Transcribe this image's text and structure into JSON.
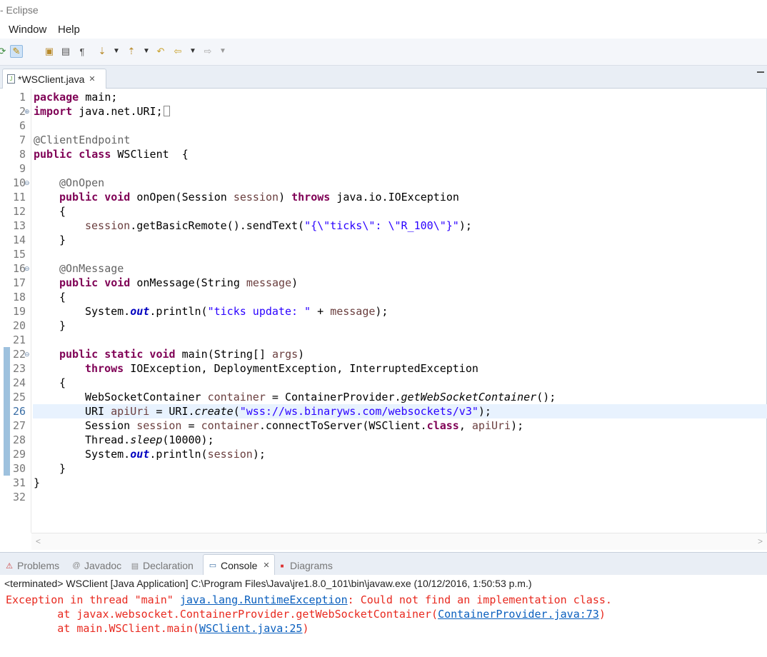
{
  "window": {
    "title": "- Eclipse"
  },
  "menu": {
    "items": [
      "Window",
      "Help"
    ]
  },
  "toolbar": {
    "icons": [
      "refresh-icon",
      "highlight-toggle-icon",
      "open-type-icon",
      "task-icon",
      "show-whitespace-icon",
      "next-annotation-icon",
      "previous-annotation-icon",
      "last-edit-location-icon",
      "back-icon",
      "forward-icon"
    ]
  },
  "editor": {
    "tab_label": "*WSClient.java",
    "tab_close": "✕",
    "highlighted_line": "26",
    "lines": [
      {
        "num": "1",
        "fold": ""
      },
      {
        "num": "2",
        "fold": "⊕"
      },
      {
        "num": "6",
        "fold": ""
      },
      {
        "num": "7",
        "fold": ""
      },
      {
        "num": "8",
        "fold": ""
      },
      {
        "num": "9",
        "fold": ""
      },
      {
        "num": "10",
        "fold": "⊖"
      },
      {
        "num": "11",
        "fold": ""
      },
      {
        "num": "12",
        "fold": ""
      },
      {
        "num": "13",
        "fold": ""
      },
      {
        "num": "14",
        "fold": ""
      },
      {
        "num": "15",
        "fold": ""
      },
      {
        "num": "16",
        "fold": "⊖"
      },
      {
        "num": "17",
        "fold": ""
      },
      {
        "num": "18",
        "fold": ""
      },
      {
        "num": "19",
        "fold": ""
      },
      {
        "num": "20",
        "fold": ""
      },
      {
        "num": "21",
        "fold": ""
      },
      {
        "num": "22",
        "fold": "⊖"
      },
      {
        "num": "23",
        "fold": ""
      },
      {
        "num": "24",
        "fold": ""
      },
      {
        "num": "25",
        "fold": ""
      },
      {
        "num": "26",
        "fold": ""
      },
      {
        "num": "27",
        "fold": ""
      },
      {
        "num": "28",
        "fold": ""
      },
      {
        "num": "29",
        "fold": ""
      },
      {
        "num": "30",
        "fold": ""
      },
      {
        "num": "31",
        "fold": ""
      },
      {
        "num": "32",
        "fold": ""
      }
    ],
    "code": {
      "l1_kw": "package",
      "l1_rest": " main;",
      "l2_kw": "import",
      "l2_rest": " java.net.URI;",
      "l7_ann": "@ClientEndpoint",
      "l8_kw": "public class",
      "l8_rest": " WSClient  {",
      "l10_ann": "@OnOpen",
      "l11_kw": "public void",
      "l11_a": " onOpen(Session ",
      "l11_var": "session",
      "l11_b": ") ",
      "l11_kw2": "throws",
      "l11_c": " java.io.IOException",
      "l12": "{",
      "l13_var": "session",
      "l13_a": ".getBasicRemote().sendText(",
      "l13_str": "\"{\\\"ticks\\\": \\\"R_100\\\"}\"",
      "l13_b": ");",
      "l14": "}",
      "l16_ann": "@OnMessage",
      "l17_kw": "public void",
      "l17_a": " onMessage(String ",
      "l17_var": "message",
      "l17_b": ")",
      "l18": "{",
      "l19_a": "System.",
      "l19_stat": "out",
      "l19_b": ".println(",
      "l19_str": "\"ticks update: \"",
      "l19_c": " + ",
      "l19_var": "message",
      "l19_d": ");",
      "l20": "}",
      "l22_kw": "public static void",
      "l22_a": " main(String[] ",
      "l22_var": "args",
      "l22_b": ")",
      "l23_kw": "throws",
      "l23_a": " IOException, DeploymentException, InterruptedException",
      "l24": "{",
      "l25_a": "WebSocketContainer ",
      "l25_var": "container",
      "l25_b": " = ContainerProvider.",
      "l25_it": "getWebSocketContainer",
      "l25_c": "();",
      "l26_a": "URI ",
      "l26_var": "apiUri",
      "l26_b": " = URI.",
      "l26_it": "create",
      "l26_c": "(",
      "l26_str": "\"wss://ws.binaryws.com/websockets/v3\"",
      "l26_d": ");",
      "l27_a": "Session ",
      "l27_var": "session",
      "l27_b": " = ",
      "l27_var2": "container",
      "l27_c": ".connectToServer(WSClient.",
      "l27_kw": "class",
      "l27_d": ", ",
      "l27_var3": "apiUri",
      "l27_e": ");",
      "l28_a": "Thread.",
      "l28_it": "sleep",
      "l28_b": "(10000);",
      "l29_a": "System.",
      "l29_stat": "out",
      "l29_b": ".println(",
      "l29_var": "session",
      "l29_c": ");",
      "l30": "}",
      "l31": "}"
    }
  },
  "panel": {
    "tabs": [
      {
        "label": "Problems",
        "icon": "problems-icon"
      },
      {
        "label": "Javadoc",
        "icon": "javadoc-icon"
      },
      {
        "label": "Declaration",
        "icon": "declaration-icon"
      },
      {
        "label": "Console",
        "icon": "console-icon",
        "active": true
      },
      {
        "label": "Diagrams",
        "icon": "diagrams-icon"
      }
    ],
    "console_close": "✕",
    "console_header": "<terminated> WSClient [Java Application] C:\\Program Files\\Java\\jre1.8.0_101\\bin\\javaw.exe (10/12/2016, 1:50:53 p.m.)",
    "output": {
      "line1_a": "Exception in thread \"main\" ",
      "line1_link": "java.lang.RuntimeException",
      "line1_b": ": Could not find an implementation class.",
      "line2_a": "        at javax.websocket.ContainerProvider.getWebSocketContainer(",
      "line2_link": "ContainerProvider.java:73",
      "line2_b": ")",
      "line3_a": "        at main.WSClient.main(",
      "line3_link": "WSClient.java:25",
      "line3_b": ")"
    }
  },
  "colors": {
    "keyword": "#7f0055",
    "string": "#2a00ff",
    "local_variable": "#6a3e3e",
    "static_field": "#0000c0",
    "error_text": "#e8291f",
    "link": "#0a5fbe",
    "current_line": "#e8f2fe"
  }
}
